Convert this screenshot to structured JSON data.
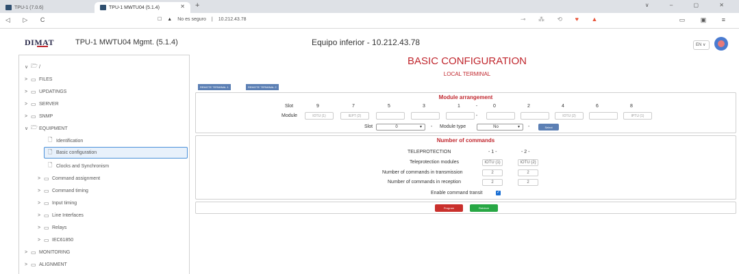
{
  "browser": {
    "tabs": [
      {
        "label": "TPU-1 (7.0.6)"
      },
      {
        "label": "TPU-1 MWTU04 (5.1.4)"
      }
    ],
    "new_tab": "+",
    "window_controls": "∨ – ▢ ✕",
    "nav_glyphs": "◁ ▷ C",
    "security": "No es seguro",
    "url": "10.212.43.78"
  },
  "app": {
    "logo": "DIMAT",
    "title": "TPU-1 MWTU04 Mgmt. (5.1.4)",
    "device": "Equipo inferior - 10.212.43.78",
    "language": "EN"
  },
  "tree": [
    {
      "label": "/",
      "chev": "∨",
      "open": true
    },
    {
      "label": "FILES",
      "chev": ">"
    },
    {
      "label": "UPDATINGS",
      "chev": ">"
    },
    {
      "label": "SERVER",
      "chev": ">"
    },
    {
      "label": "SNMP",
      "chev": ">"
    },
    {
      "label": "EQUIPMENT",
      "chev": "∨",
      "open": true
    },
    {
      "label": "Identification",
      "chev": ""
    },
    {
      "label": "Basic configuration",
      "chev": "",
      "selected": true
    },
    {
      "label": "Clocks and Synchronism",
      "chev": ""
    },
    {
      "label": "Command assignment",
      "chev": ">"
    },
    {
      "label": "Command timing",
      "chev": ">"
    },
    {
      "label": "Input timing",
      "chev": ">"
    },
    {
      "label": "Line Interfaces",
      "chev": ">"
    },
    {
      "label": "Relays",
      "chev": ">"
    },
    {
      "label": "IEC61850",
      "chev": ">"
    },
    {
      "label": "MONITORING",
      "chev": ">"
    },
    {
      "label": "ALIGNMENT",
      "chev": ">"
    }
  ],
  "page": {
    "title": "BASIC CONFIGURATION",
    "subtitle": "LOCAL TERMINAL",
    "remote_buttons": [
      "REMOTE TERMINAL 1",
      "REMOTE TERMINAL 2"
    ]
  },
  "arrangement": {
    "title": "Module arrangement",
    "slot_label": "Slot",
    "module_label": "Module",
    "slots": [
      "9",
      "7",
      "5",
      "3",
      "1",
      "-",
      "0",
      "2",
      "4",
      "6",
      "8"
    ],
    "modules": [
      "IOTU (1)",
      "IEPT (2)",
      "",
      "",
      "",
      "-",
      "",
      "",
      "IOTU (2)",
      "",
      "IPTU (1)"
    ],
    "slot_select_label": "Slot",
    "slot_select_value": "0",
    "dash": "-",
    "module_type_label": "Module type",
    "module_type_value": "No",
    "select_button": "Select"
  },
  "commands": {
    "title": "Number of commands",
    "rows": [
      {
        "label": "TELEPROTECTION",
        "v1": "- 1 -",
        "v2": "- 2 -"
      },
      {
        "label": "Teleprotection modules",
        "v1": "IOTU (1)",
        "v2": "IOTU (2)"
      },
      {
        "label": "Number of commands in transmission",
        "v1": "2",
        "v2": "2"
      },
      {
        "label": "Number of commands in reception",
        "v1": "2",
        "v2": "2"
      }
    ],
    "transit_label": "Enable command transit",
    "transit_checked": true
  },
  "actions": {
    "program": "Program",
    "retrieve": "Retrieve"
  },
  "colors": {
    "accent_red": "#c0262d",
    "program_btn": "#c9302c",
    "retrieve_btn": "#27a744",
    "remote_btn": "#5b7fb4"
  }
}
